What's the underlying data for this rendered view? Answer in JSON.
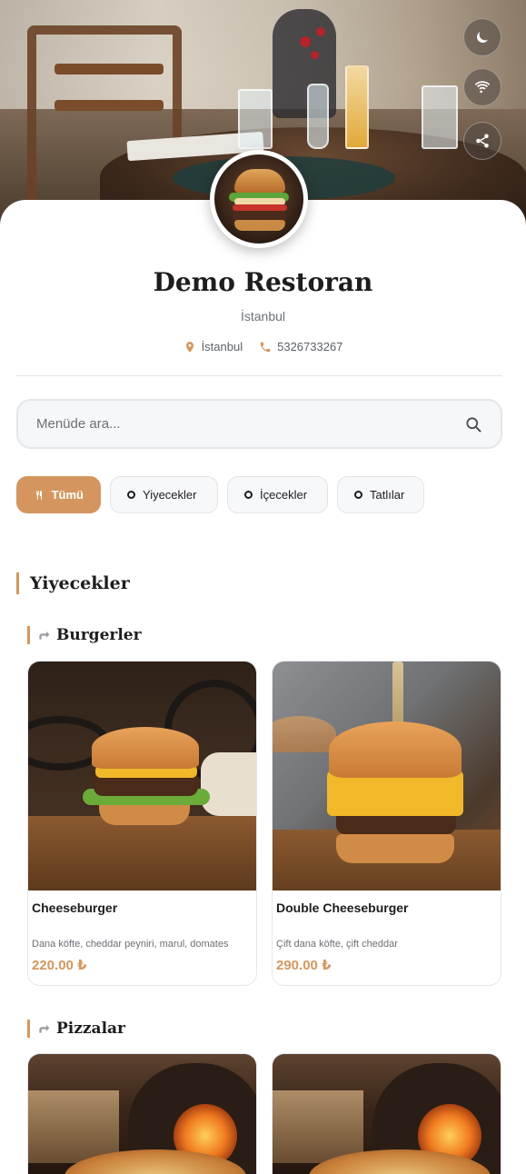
{
  "restaurant": {
    "name": "Demo Restoran",
    "city": "İstanbul",
    "location": "İstanbul",
    "phone": "5326733267"
  },
  "hero_actions": [
    {
      "icon": "moon-icon"
    },
    {
      "icon": "wifi-icon"
    },
    {
      "icon": "share-icon"
    }
  ],
  "search": {
    "placeholder": "Menüde ara..."
  },
  "categories": [
    {
      "label": "Tümü",
      "active": true,
      "icon": "utensils-icon"
    },
    {
      "label": "Yiyecekler",
      "active": false
    },
    {
      "label": "İçecekler",
      "active": false
    },
    {
      "label": "Tatlılar",
      "active": false
    }
  ],
  "section": {
    "title": "Yiyecekler",
    "subsections": [
      {
        "title": "Burgerler",
        "items": [
          {
            "name": "Cheeseburger",
            "description": "Dana köfte, cheddar peyniri, marul, domates",
            "price": "220.00 ₺"
          },
          {
            "name": "Double Cheeseburger",
            "description": "Çift dana köfte, çift cheddar",
            "price": "290.00 ₺"
          }
        ]
      },
      {
        "title": "Pizzalar",
        "items": [
          {
            "name": "",
            "description": "",
            "price": ""
          },
          {
            "name": "",
            "description": "",
            "price": ""
          }
        ]
      }
    ]
  },
  "colors": {
    "accent": "#d4965e",
    "text": "#1d1d1f",
    "muted": "#6b6f76"
  }
}
